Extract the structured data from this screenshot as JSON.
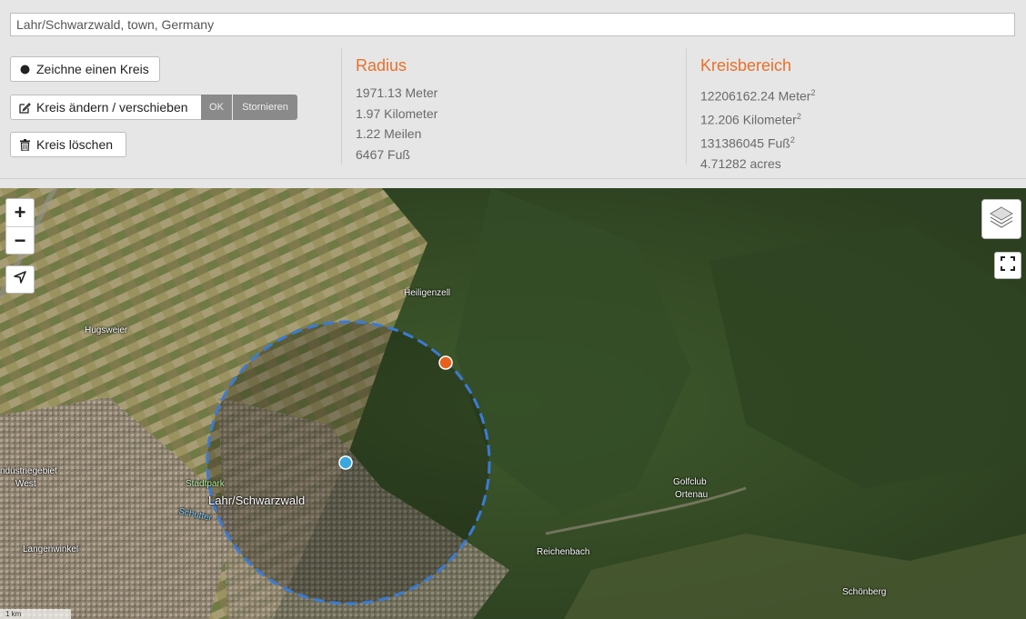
{
  "search": {
    "value": "Lahr/Schwarzwald, town, Germany"
  },
  "buttons": {
    "draw": "Zeichne einen Kreis",
    "edit": "Kreis ändern / verschieben",
    "ok": "OK",
    "cancel": "Stornieren",
    "clear": "Kreis löschen"
  },
  "radius": {
    "title": "Radius",
    "meter": "1971.13 Meter",
    "kilometer": "1.97 Kilometer",
    "miles": "1.22 Meilen",
    "feet": "6467 Fuß"
  },
  "area": {
    "title": "Kreisbereich",
    "meter": "12206162.24 Meter",
    "kilometer": "12.206 Kilometer",
    "feet": "131386045 Fuß",
    "acres": "4.71282 acres",
    "sup": "2"
  },
  "map": {
    "zoom_in": "+",
    "zoom_out": "−",
    "scale": "1 km",
    "labels": {
      "heiligenzell": "Heiligenzell",
      "hugsweier": "Hugsweier",
      "industriegebiet": "ndustriegebiet",
      "west": "West",
      "stadtpark": "Stadtpark",
      "lahr": "Lahr/Schwarzwald",
      "schutter": "Schutter",
      "langenwinkel": "Langenwinkel",
      "golfclub": "Golfclub",
      "ortenau": "Ortenau",
      "reichenbach": "Reichenbach",
      "schonberg": "Schönberg"
    },
    "colors": {
      "circle": "#3a7bd5",
      "center": "#3aa8e0",
      "edge": "#e8601c"
    }
  }
}
